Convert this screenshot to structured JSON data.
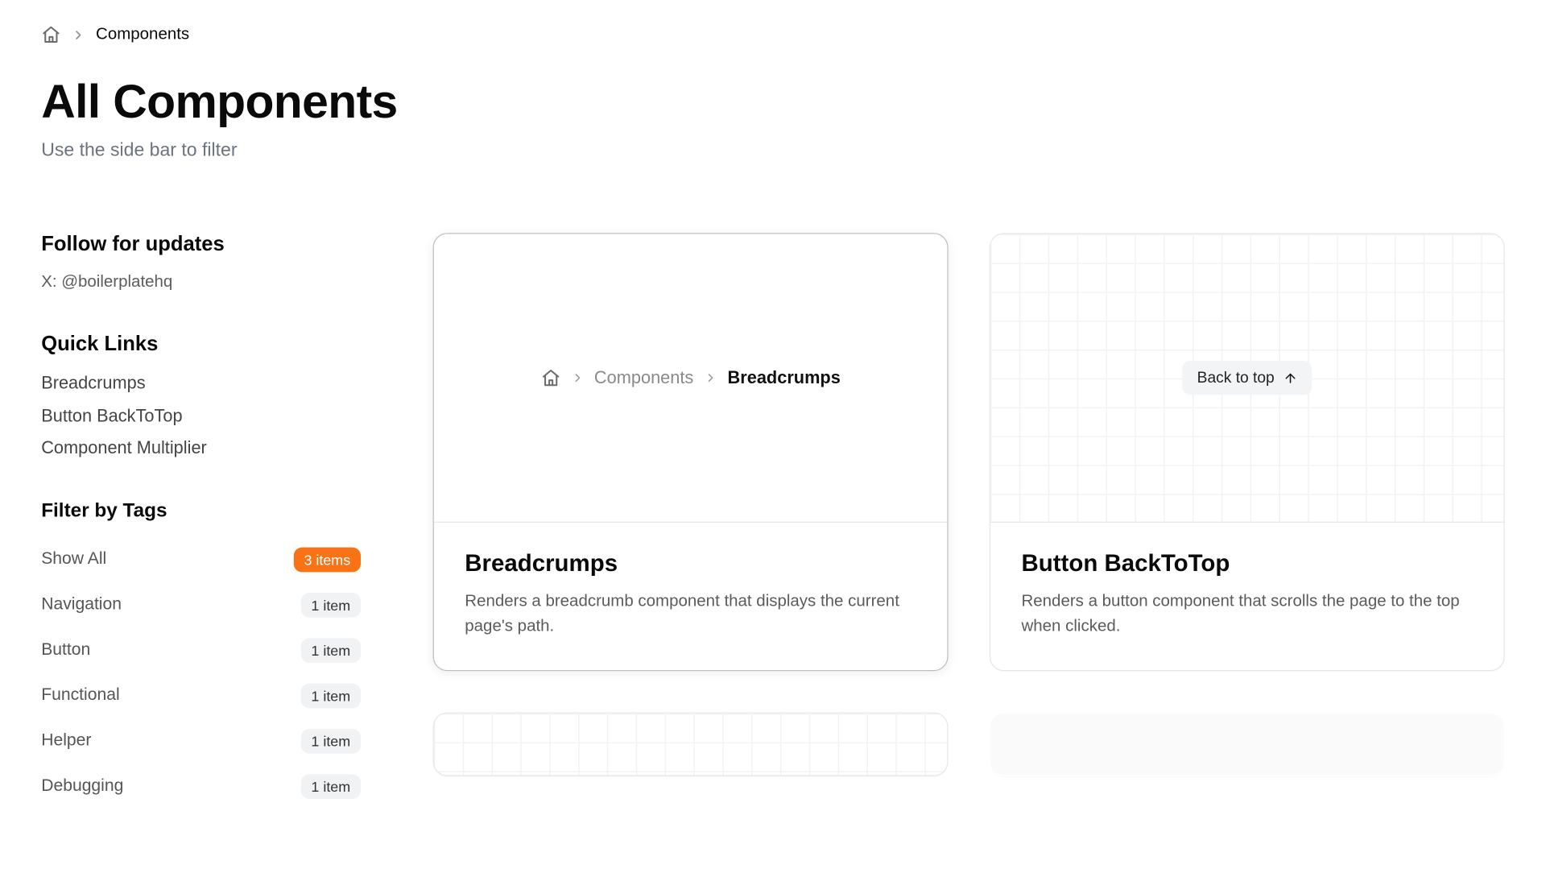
{
  "breadcrumb": {
    "current": "Components"
  },
  "header": {
    "title": "All Components",
    "subtitle": "Use the side bar to filter"
  },
  "sidebar": {
    "follow": {
      "heading": "Follow for updates",
      "line": "X: @boilerplatehq"
    },
    "quicklinks": {
      "heading": "Quick Links",
      "items": [
        "Breadcrumps",
        "Button BackToTop",
        "Component Multiplier"
      ]
    },
    "tags": {
      "heading": "Filter by Tags",
      "rows": [
        {
          "label": "Show All",
          "badge": "3 items",
          "active": true
        },
        {
          "label": "Navigation",
          "badge": "1 item",
          "active": false
        },
        {
          "label": "Button",
          "badge": "1 item",
          "active": false
        },
        {
          "label": "Functional",
          "badge": "1 item",
          "active": false
        },
        {
          "label": "Helper",
          "badge": "1 item",
          "active": false
        },
        {
          "label": "Debugging",
          "badge": "1 item",
          "active": false
        }
      ]
    }
  },
  "cards": [
    {
      "title": "Breadcrumps",
      "desc": "Renders a breadcrumb component that displays the current page's path.",
      "preview_crumbs": [
        "Components",
        "Breadcrumps"
      ]
    },
    {
      "title": "Button BackToTop",
      "desc": "Renders a button component that scrolls the page to the top when clicked.",
      "btt_label": "Back to top"
    }
  ]
}
